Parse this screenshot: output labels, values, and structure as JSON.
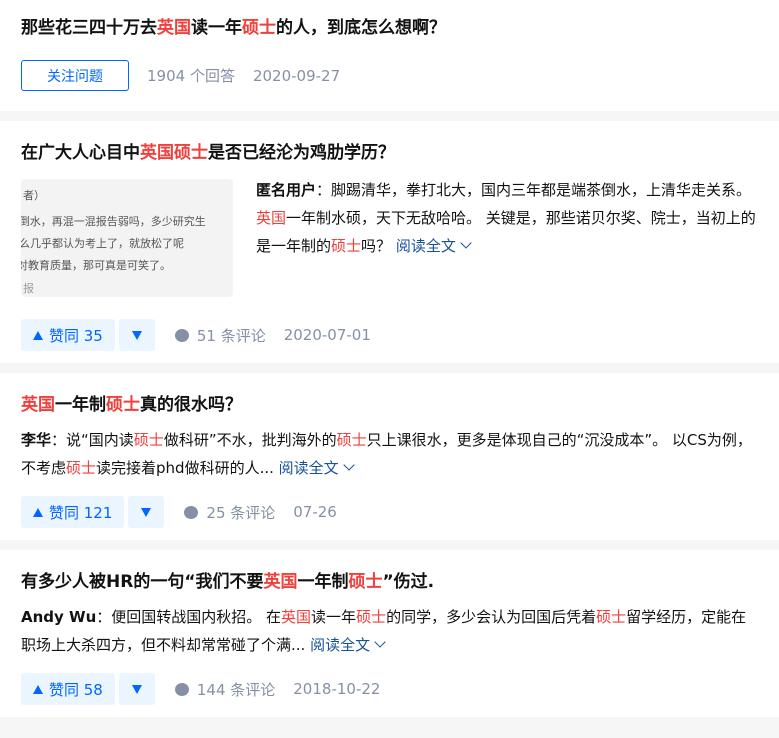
{
  "question_card": {
    "title_parts": [
      "那些花三四十万去",
      "英国",
      "读一年",
      "硕士",
      "的人，到底怎么想啊？"
    ],
    "follow_label": "关注问题",
    "answers_text": "1904 个回答",
    "date": "2020-09-27"
  },
  "answers": [
    {
      "title_parts": [
        "在广大人心目中",
        "英国硕士",
        "是否已经沦为鸡肋学历？"
      ],
      "thumbnail_lines": [
        "者）",
        ":倒水，再混一混报告弱吗，多少研究生",
        "么几乎都认为考上了，就放松了呢",
        "对教育质量，那可真是可笑了。",
        "报"
      ],
      "author": "匿名用户",
      "excerpt_parts": [
        "：脚踢清华，拳打北大，国内三年都是端茶倒水，上清华走关系。",
        "英国",
        "一年制水硕，天下无敌哈哈。 关键是，那些诺贝尔奖、院士，当初上的是一年制的",
        "硕士",
        "吗？"
      ],
      "read_more": "阅读全文",
      "votes": "赞同 35",
      "comments": "51 条评论",
      "date": "2020-07-01"
    },
    {
      "title_parts": [
        "英国",
        "一年制",
        "硕士",
        "真的很水吗？"
      ],
      "author": "李华",
      "excerpt_parts": [
        "：说“国内读",
        "硕士",
        "做科研”不水，批判海外的",
        "硕士",
        "只上课很水，更多是体现自己的“沉没成本”。 以CS为例，不考虑",
        "硕士",
        "读完接着phd做科研的人..."
      ],
      "read_more": "阅读全文",
      "votes": "赞同 121",
      "comments": "25 条评论",
      "date": "07-26"
    },
    {
      "title_parts": [
        "有多少人被HR的一句“我们不要",
        "英国",
        "一年制",
        "硕士",
        "”伤过."
      ],
      "author": "Andy Wu",
      "excerpt_parts": [
        "：便回国转战国内秋招。 在",
        "英国",
        "读一年",
        "硕士",
        "的同学，多少会认为回国后凭着",
        "硕士",
        "留学经历，定能在职场上大杀四方，但不料却常常碰了个满..."
      ],
      "read_more": "阅读全文",
      "votes": "赞同 58",
      "comments": "144 条评论",
      "date": "2018-10-22"
    }
  ],
  "colors": {
    "highlight": "#f1403c",
    "brand_blue": "#0066ff",
    "link_blue": "#175199",
    "meta_gray": "#8590a6"
  }
}
